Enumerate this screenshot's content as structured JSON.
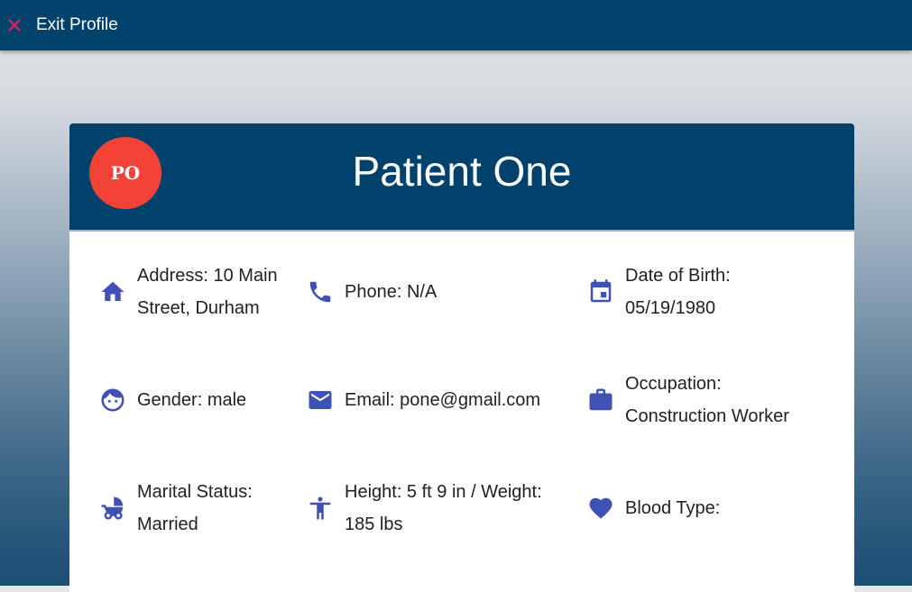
{
  "topbar": {
    "exit_label": "Exit Profile"
  },
  "header": {
    "avatar_initials": "PO",
    "patient_name": "Patient One"
  },
  "colors": {
    "primary": "#00426c",
    "avatar": "#f44336",
    "icon": "#3f51b5",
    "close": "#e91e63"
  },
  "fields": {
    "address": {
      "icon": "home-icon",
      "text": "Address: 10 Main Street, Durham"
    },
    "phone": {
      "icon": "phone-icon",
      "text": "Phone: N/A"
    },
    "dob": {
      "icon": "calendar-icon",
      "text": "Date of Birth: 05/19/1980"
    },
    "gender": {
      "icon": "face-icon",
      "text": "Gender: male"
    },
    "email": {
      "icon": "email-icon",
      "text": "Email: pone@gmail.com"
    },
    "occupation": {
      "icon": "briefcase-icon",
      "text": "Occupation: Construction Worker"
    },
    "marital": {
      "icon": "stroller-icon",
      "text": "Marital Status: Married"
    },
    "height_weight": {
      "icon": "person-icon",
      "text": "Height: 5 ft 9 in / Weight: 185 lbs"
    },
    "blood_type": {
      "icon": "heart-icon",
      "text": "Blood Type:"
    }
  }
}
